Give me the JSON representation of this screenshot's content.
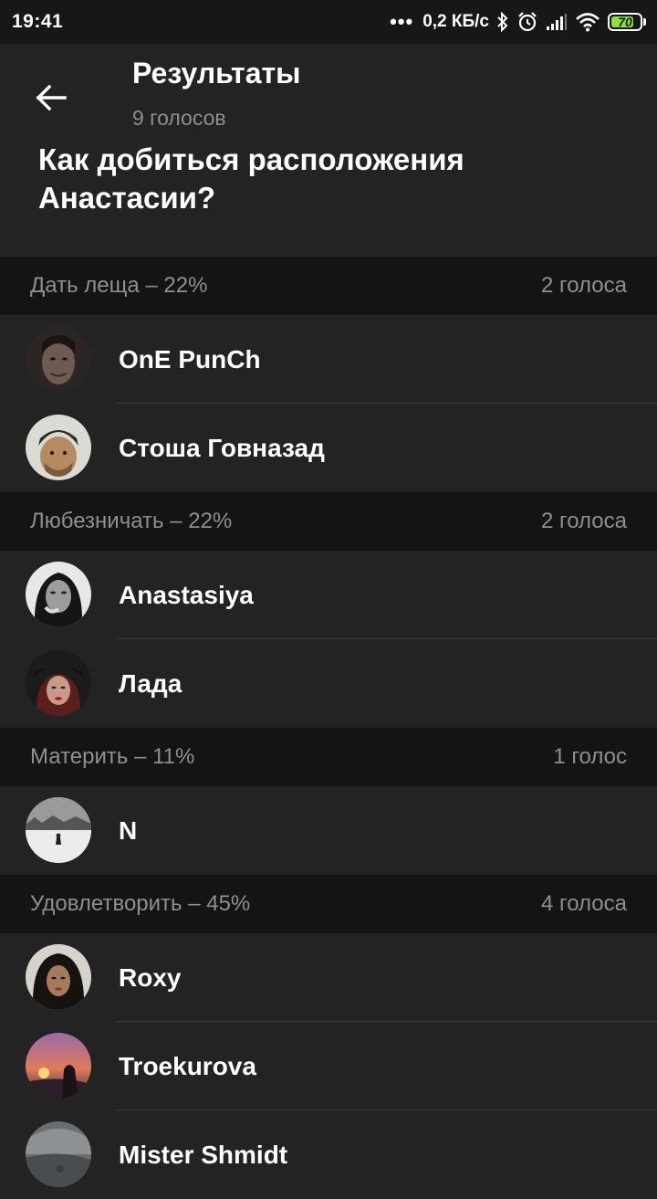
{
  "status_bar": {
    "time": "19:41",
    "dots": "•••",
    "speed": "0,2 КБ/с",
    "battery": "70",
    "icons": [
      "bluetooth-icon",
      "alarm-icon",
      "signal-icon",
      "wifi-icon",
      "battery-icon"
    ]
  },
  "header": {
    "title": "Результаты",
    "subtitle": "9 голосов",
    "question": "Как добиться расположения Анастасии?"
  },
  "sections": [
    {
      "option": "Дать леща – 22%",
      "votes": "2 голоса",
      "voters": [
        "OnE PunCh",
        "Стоша Говназад"
      ]
    },
    {
      "option": "Любезничать – 22%",
      "votes": "2 голоса",
      "voters": [
        "Anastasiya",
        "Лада"
      ]
    },
    {
      "option": "Материть – 11%",
      "votes": "1 голос",
      "voters": [
        "N"
      ]
    },
    {
      "option": "Удовлетворить – 45%",
      "votes": "4 голоса",
      "voters": [
        "Roxy",
        "Troekurova",
        "Mister Shmidt"
      ]
    }
  ],
  "colors": {
    "background": "#232323",
    "section_header_bg": "#141414",
    "status_bar_bg": "#171717",
    "secondary_text": "#8f8f8f",
    "battery_green": "#8ee13a"
  }
}
